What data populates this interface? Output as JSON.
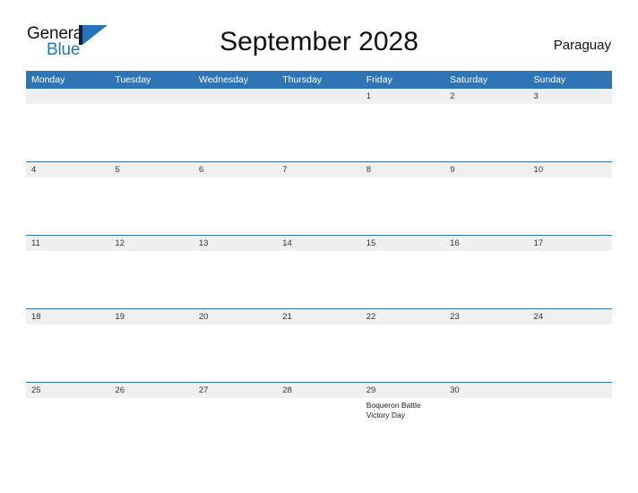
{
  "brand": {
    "name_part1": "General",
    "name_part2": "Blue",
    "logo_icon": "general-blue-triangle-logo"
  },
  "header": {
    "title": "September 2028",
    "region": "Paraguay"
  },
  "colors": {
    "header_blue": "#2f74b5",
    "brand_blue": "#2573b9",
    "day_band_gray": "#f0f0f0",
    "text_dark": "#111111",
    "page_background": "#ffffff"
  },
  "calendar": {
    "month": "September",
    "year": "2028",
    "weekday_headers": [
      "Monday",
      "Tuesday",
      "Wednesday",
      "Thursday",
      "Friday",
      "Saturday",
      "Sunday"
    ],
    "weeks": [
      [
        {
          "date": "",
          "events": []
        },
        {
          "date": "",
          "events": []
        },
        {
          "date": "",
          "events": []
        },
        {
          "date": "",
          "events": []
        },
        {
          "date": "1",
          "events": []
        },
        {
          "date": "2",
          "events": []
        },
        {
          "date": "3",
          "events": []
        }
      ],
      [
        {
          "date": "4",
          "events": []
        },
        {
          "date": "5",
          "events": []
        },
        {
          "date": "6",
          "events": []
        },
        {
          "date": "7",
          "events": []
        },
        {
          "date": "8",
          "events": []
        },
        {
          "date": "9",
          "events": []
        },
        {
          "date": "10",
          "events": []
        }
      ],
      [
        {
          "date": "11",
          "events": []
        },
        {
          "date": "12",
          "events": []
        },
        {
          "date": "13",
          "events": []
        },
        {
          "date": "14",
          "events": []
        },
        {
          "date": "15",
          "events": []
        },
        {
          "date": "16",
          "events": []
        },
        {
          "date": "17",
          "events": []
        }
      ],
      [
        {
          "date": "18",
          "events": []
        },
        {
          "date": "19",
          "events": []
        },
        {
          "date": "20",
          "events": []
        },
        {
          "date": "21",
          "events": []
        },
        {
          "date": "22",
          "events": []
        },
        {
          "date": "23",
          "events": []
        },
        {
          "date": "24",
          "events": []
        }
      ],
      [
        {
          "date": "25",
          "events": []
        },
        {
          "date": "26",
          "events": []
        },
        {
          "date": "27",
          "events": []
        },
        {
          "date": "28",
          "events": []
        },
        {
          "date": "29",
          "events": [
            "Boqueron Battle",
            "Victory Day"
          ]
        },
        {
          "date": "30",
          "events": []
        },
        {
          "date": "",
          "events": []
        }
      ]
    ]
  }
}
